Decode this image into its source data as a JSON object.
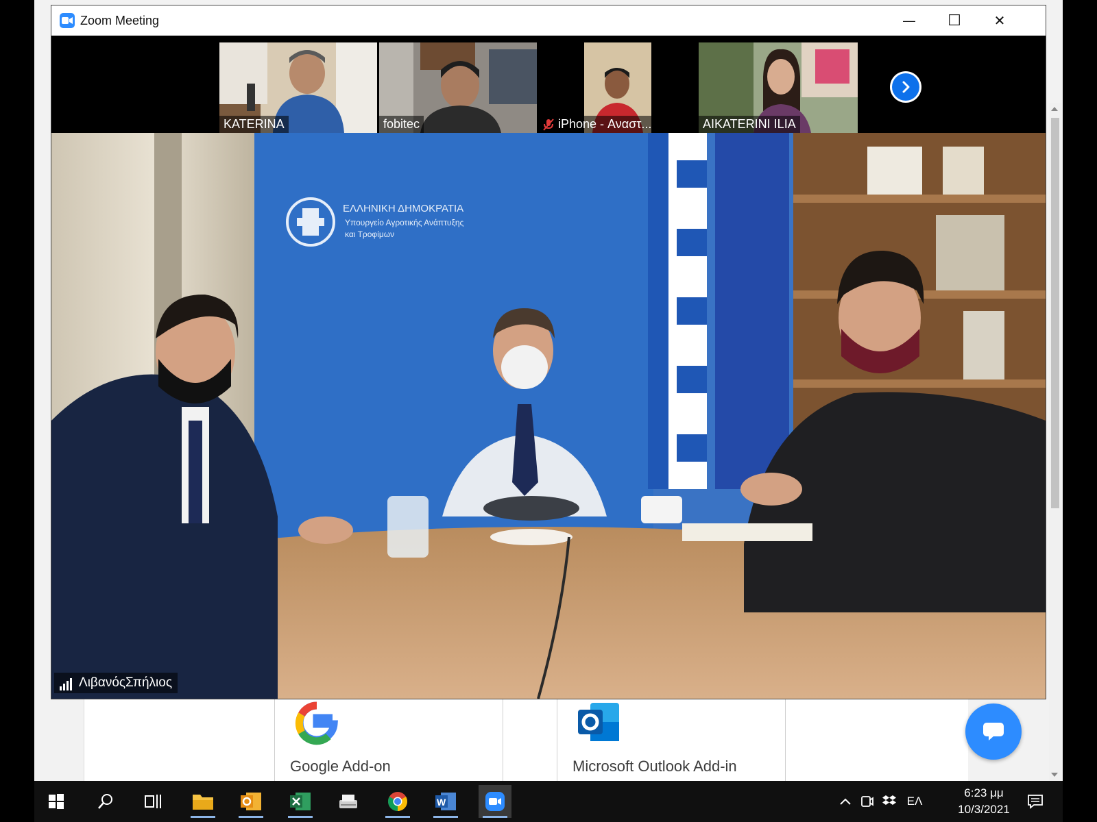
{
  "window": {
    "title": "Zoom Meeting",
    "minimize_glyph": "—",
    "maximize_glyph": "☐",
    "close_glyph": "✕"
  },
  "gallery": {
    "participants": [
      {
        "name": "KATERINA",
        "muted": false
      },
      {
        "name": "fobitec",
        "muted": false
      },
      {
        "name": "iPhone - Αναστ...",
        "muted": true
      },
      {
        "name": "AIKATERINI ILIA",
        "muted": false
      }
    ],
    "next_icon": "chevron-right-icon"
  },
  "main_video": {
    "speaker_name": "ΛιβανόςΣπήλιος",
    "banner_title": "ΕΛΛΗΝΙΚΗ ΔΗΜΟΚΡΑΤΙΑ",
    "banner_subtitle_1": "Υπουργείο Αγροτικής Ανάπτυξης",
    "banner_subtitle_2": "και Τροφίμων"
  },
  "background_page": {
    "addons": [
      {
        "label": "Google Add-on",
        "logo": "google-logo"
      },
      {
        "label": "Microsoft Outlook Add-in",
        "logo": "outlook-logo"
      }
    ]
  },
  "taskbar": {
    "apps": [
      "windows-start",
      "search",
      "task-view",
      "file-explorer",
      "outlook",
      "excel",
      "scanner",
      "chrome",
      "word",
      "zoom"
    ],
    "language": "ΕΛ",
    "time": "6:23 μμ",
    "date": "10/3/2021"
  },
  "colors": {
    "zoom_blue": "#2d8cff",
    "next_btn_blue": "#0e71eb",
    "banner_blue": "#2f6fc6",
    "taskbar": "#101010"
  }
}
